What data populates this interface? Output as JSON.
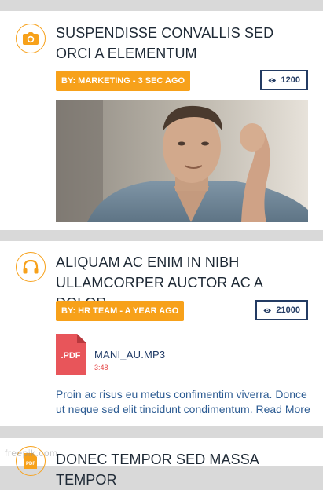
{
  "posts": [
    {
      "icon": "camera-icon",
      "title": "SUSPENDISSE CONVALLIS SED ORCI A ELEMENTUM",
      "byline": "BY: MARKETING - 3 SEC AGO",
      "views": "1200"
    },
    {
      "icon": "headphones-icon",
      "title": "ALIQUAM AC ENIM IN NIBH ULLAMCORPER AUCTOR AC A DOLOR",
      "byline": "BY: HR TEAM - A YEAR AGO",
      "views": "21000",
      "attachment": {
        "type_label": ".PDF",
        "name": "MANI_AU.MP3",
        "duration": "3:48"
      },
      "excerpt": "Proin ac risus eu metus confimentim viverra. Donce ut neque sed elit tincidunt condimentum. Read More"
    },
    {
      "icon": "pdf-icon",
      "icon_label": "PDF",
      "title": "DONEC TEMPOR SED MASSA TEMPOR"
    }
  ],
  "watermark": "freepik.com",
  "colors": {
    "accent": "#f7a11a",
    "navy": "#233b63",
    "link": "#2d5c93",
    "pdf_red": "#e8555a"
  }
}
